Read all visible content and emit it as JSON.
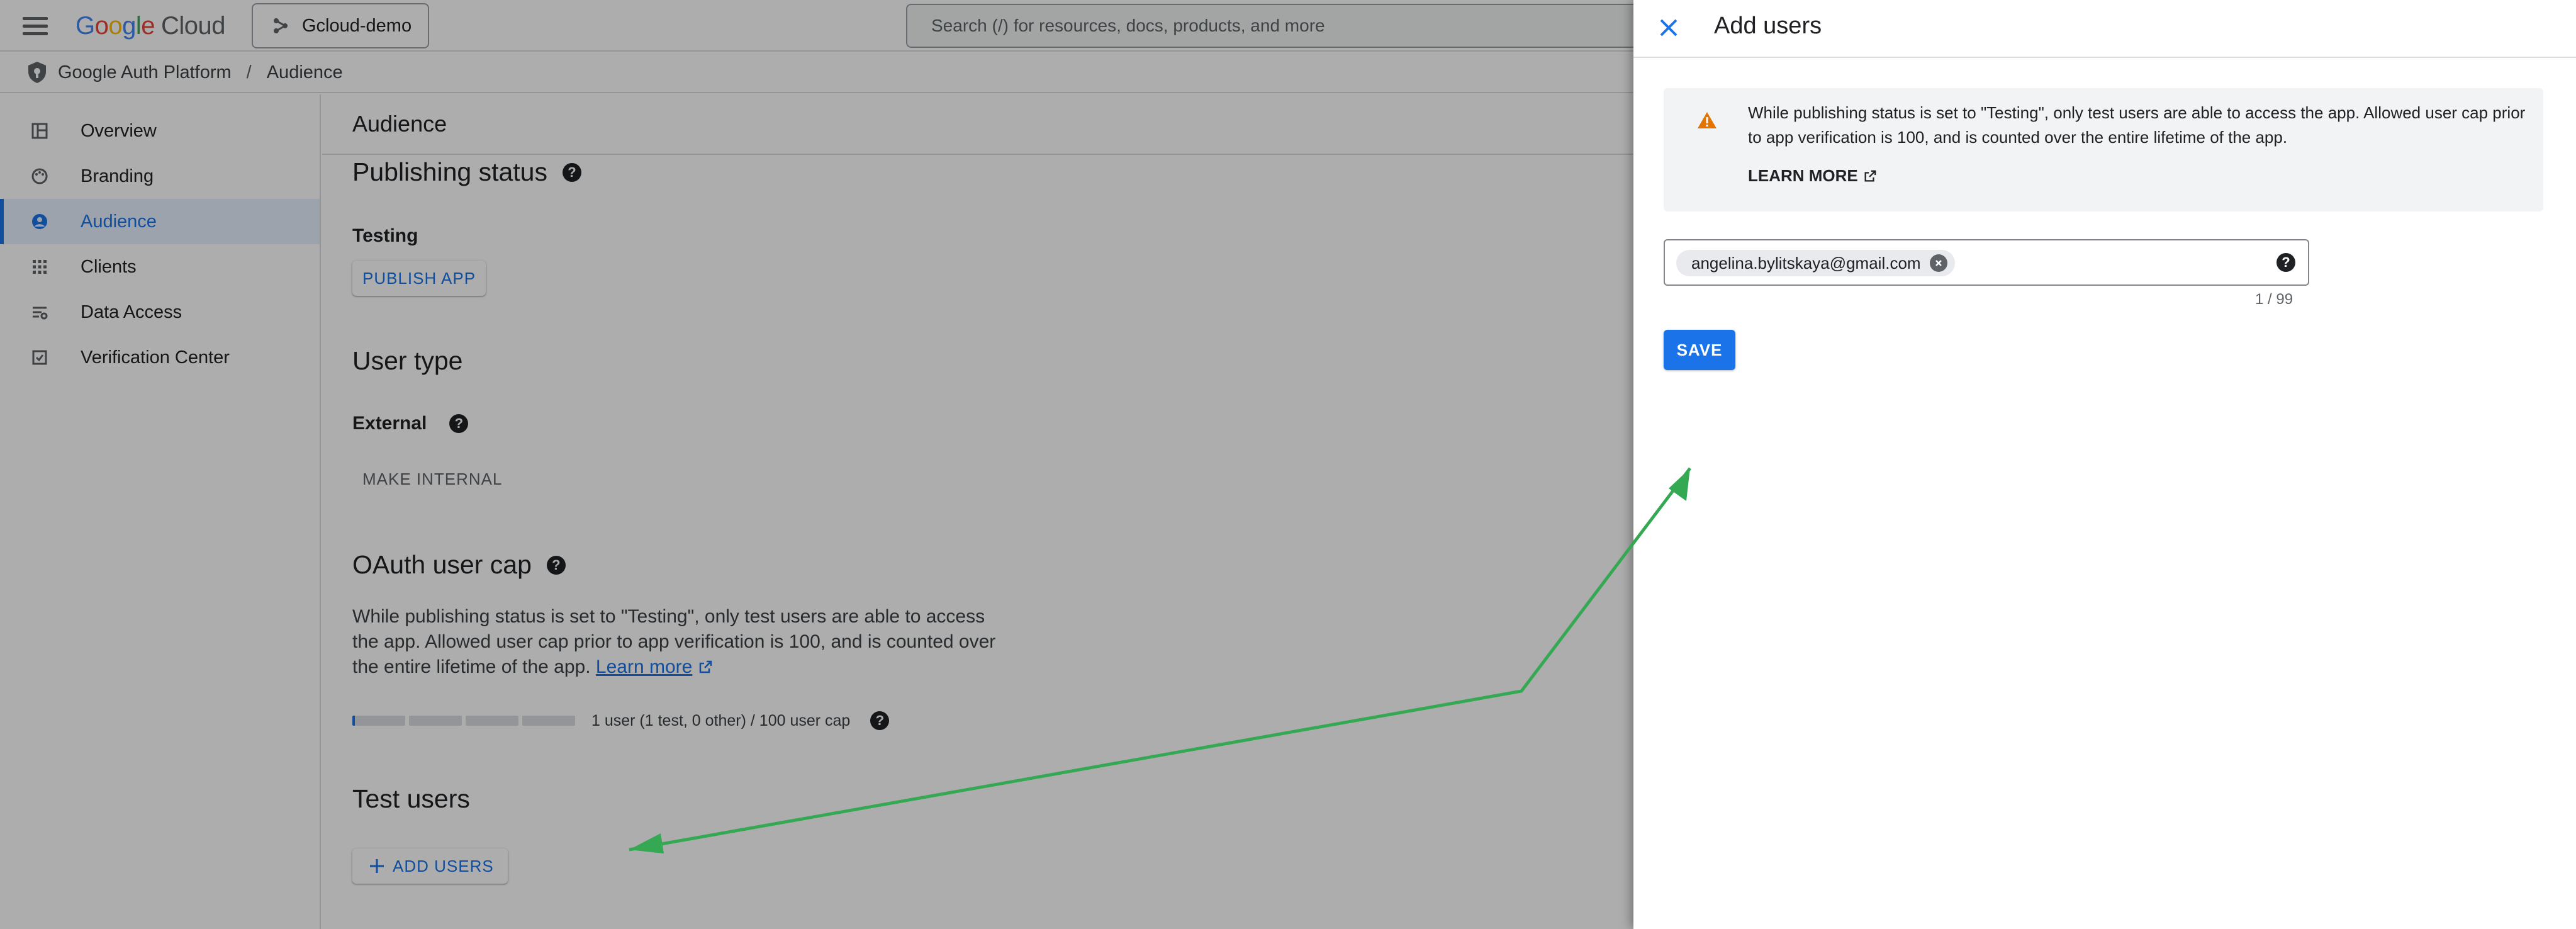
{
  "header": {
    "logo_google_letters": [
      "G",
      "o",
      "o",
      "g",
      "l",
      "e"
    ],
    "logo_cloud": "Cloud",
    "project": "Gcloud-demo",
    "search_placeholder": "Search (/) for resources, docs, products, and more"
  },
  "breadcrumb": {
    "platform": "Google Auth Platform",
    "separator": "/",
    "current": "Audience"
  },
  "sidebar": {
    "items": [
      {
        "label": "Overview",
        "icon": "dashboard-icon"
      },
      {
        "label": "Branding",
        "icon": "palette-icon"
      },
      {
        "label": "Audience",
        "icon": "person-icon",
        "active": true
      },
      {
        "label": "Clients",
        "icon": "grid-icon"
      },
      {
        "label": "Data Access",
        "icon": "tune-icon"
      },
      {
        "label": "Verification Center",
        "icon": "checkbox-icon"
      }
    ]
  },
  "main": {
    "title": "Audience",
    "publishing_status": {
      "heading": "Publishing status",
      "status": "Testing",
      "publish_button": "PUBLISH APP"
    },
    "user_type": {
      "heading": "User type",
      "value": "External",
      "make_internal_button": "MAKE INTERNAL"
    },
    "user_cap": {
      "heading": "OAuth user cap",
      "description": "While publishing status is set to \"Testing\", only test users are able to access the app. Allowed user cap prior to app verification is 100, and is counted over the entire lifetime of the app.",
      "learn_more": "Learn more",
      "usage_fraction": 0.01,
      "usage_text": "1 user (1 test, 0 other) / 100 user cap"
    },
    "test_users": {
      "heading": "Test users",
      "add_button": "ADD USERS"
    }
  },
  "panel": {
    "title": "Add users",
    "notice_text": "While publishing status is set to \"Testing\", only test users are able to access the app. Allowed user cap prior to app verification is 100, and is counted over the entire lifetime of the app.",
    "learn_more": "LEARN MORE",
    "emails": [
      "angelina.bylitskaya@gmail.com"
    ],
    "counter": "1 / 99",
    "save_button": "SAVE"
  },
  "colors": {
    "accent": "#1a73e8",
    "warning": "#e37400",
    "annotation_arrow": "#34a853"
  }
}
